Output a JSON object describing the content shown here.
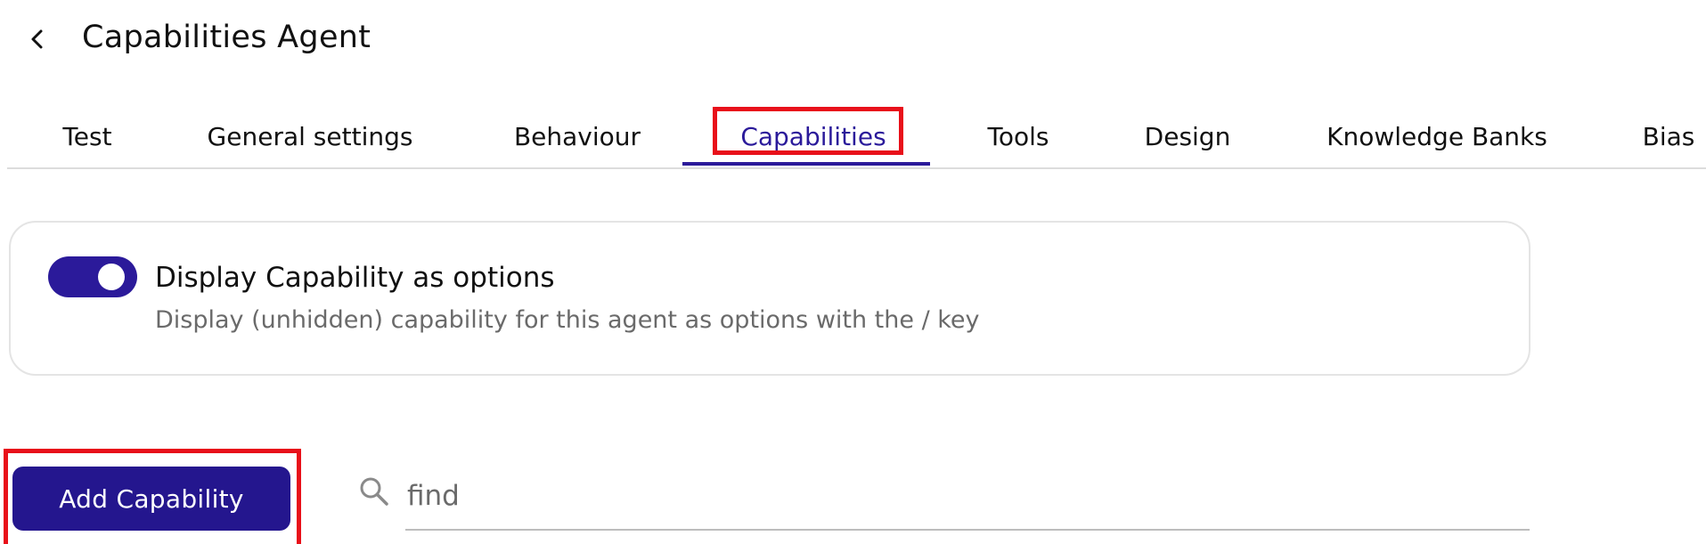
{
  "header": {
    "back_icon": "chevron-left-icon",
    "title": "Capabilities Agent"
  },
  "tabs": [
    {
      "label": "Test",
      "active": false
    },
    {
      "label": "General settings",
      "active": false
    },
    {
      "label": "Behaviour",
      "active": false
    },
    {
      "label": "Capabilities",
      "active": true
    },
    {
      "label": "Tools",
      "active": false
    },
    {
      "label": "Design",
      "active": false
    },
    {
      "label": "Knowledge Banks",
      "active": false
    },
    {
      "label": "Bias",
      "active": false
    }
  ],
  "capability_option": {
    "enabled": true,
    "title": "Display Capability as options",
    "description": "Display (unhidden) capability for this agent as options with the / key"
  },
  "actions": {
    "add_label": "Add Capability"
  },
  "search": {
    "icon": "search-icon",
    "placeholder": "find",
    "value": ""
  },
  "colors": {
    "accent": "#2b1a9a",
    "button": "#24168e",
    "highlight": "#e8101a"
  }
}
